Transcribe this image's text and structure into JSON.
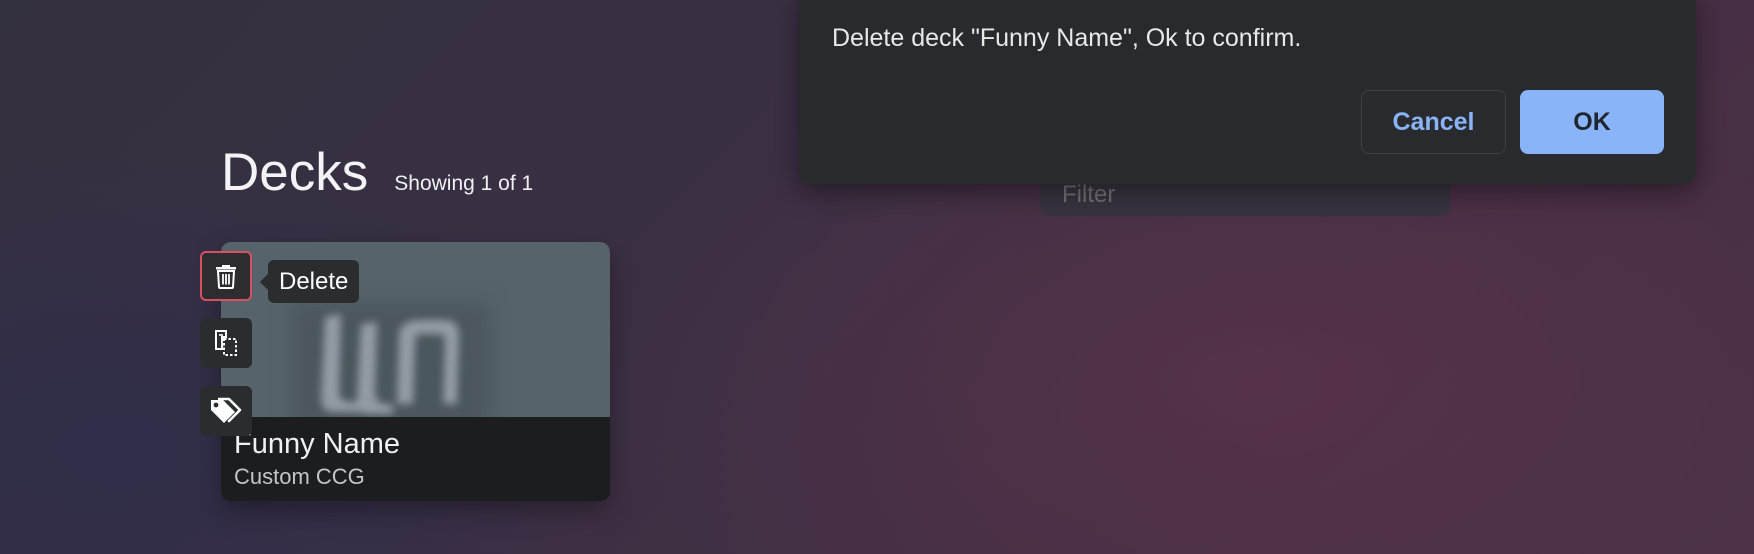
{
  "dialog": {
    "message": "Delete deck \"Funny Name\", Ok to confirm.",
    "cancel_label": "Cancel",
    "ok_label": "OK"
  },
  "page": {
    "title": "Decks",
    "showing": "Showing 1 of 1"
  },
  "filter": {
    "placeholder": "Filter",
    "value": ""
  },
  "deck": {
    "name": "Funny Name",
    "type": "Custom CCG"
  },
  "actions": {
    "delete_icon": "trash-icon",
    "copy_icon": "copy-icon",
    "tags_icon": "tags-icon",
    "tooltip": "Delete"
  },
  "colors": {
    "accent": "#8ab4f8",
    "danger_outline": "#d8505f",
    "dialog_bg": "#292a2d"
  }
}
